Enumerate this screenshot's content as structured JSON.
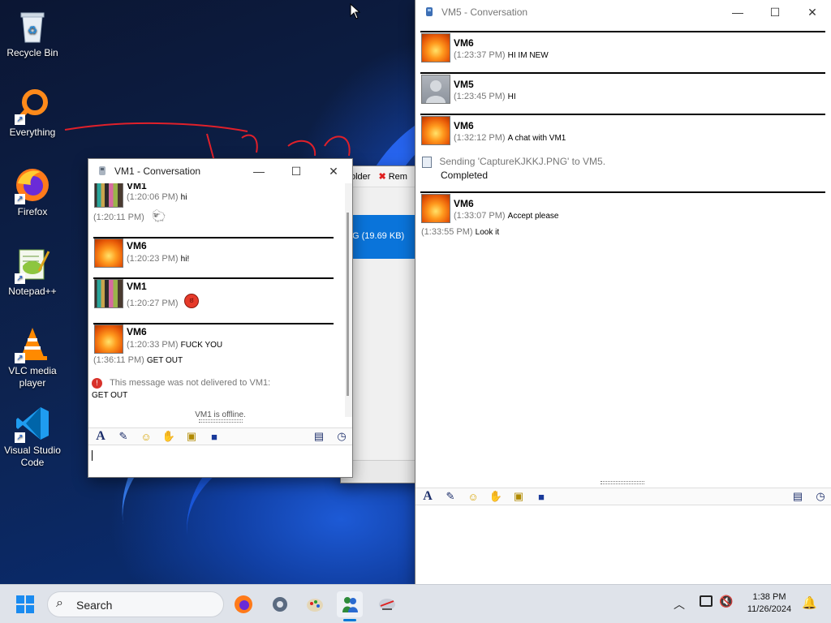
{
  "desktop": {
    "icons": [
      {
        "label": "Recycle Bin",
        "icon": "recycle-bin-icon"
      },
      {
        "label": "Everything",
        "icon": "everything-search-icon"
      },
      {
        "label": "Firefox",
        "icon": "firefox-icon"
      },
      {
        "label": "Notepad++",
        "icon": "notepad-plus-plus-icon"
      },
      {
        "label": "VLC media player",
        "icon": "vlc-cone-icon"
      },
      {
        "label": "Visual Studio Code",
        "icon": "vscode-icon"
      }
    ]
  },
  "background_window": {
    "toolbar_fragment_1": "older",
    "toolbar_fragment_2": "Rem",
    "selected_fragment": "G (19.69 KB)"
  },
  "vm1_window": {
    "title": "VM1 - Conversation",
    "messages": [
      {
        "name": "VM1",
        "time": "(1:20:06 PM)",
        "text": "hi"
      },
      {
        "time": "(1:20:11 PM)",
        "text": "",
        "emoticon": "sheep-emoticon"
      },
      {
        "name": "VM6",
        "time": "(1:20:23 PM)",
        "text": "hi!"
      },
      {
        "name": "VM1",
        "time": "(1:20:27 PM)",
        "text": "",
        "emoticon": "angry-face-emoticon"
      },
      {
        "name": "VM6",
        "time": "(1:20:33 PM)",
        "text": "FUCK YOU"
      },
      {
        "time": "(1:36:11 PM)",
        "text": "GET OUT"
      }
    ],
    "error_text": "This message was not delivered to VM1:",
    "error_body": "GET OUT",
    "status": "VM1 is offline.",
    "input_value": ""
  },
  "vm5_window": {
    "title": "VM5 - Conversation",
    "messages": [
      {
        "name": "VM6",
        "time": "(1:23:37 PM)",
        "text": "HI IM NEW"
      },
      {
        "name": "VM5",
        "time": "(1:23:45 PM)",
        "text": "HI"
      },
      {
        "name": "VM6",
        "time": "(1:32:12 PM)",
        "text": "A chat with VM1"
      },
      {
        "name": "VM6",
        "time": "(1:33:07 PM)",
        "text": "Accept please"
      },
      {
        "time": "(1:33:55 PM)",
        "text": "Look it"
      }
    ],
    "transfer_line1": "Sending 'CaptureKJKKJ.PNG' to VM5.",
    "transfer_line2": "Completed",
    "input_value": ""
  },
  "taskbar": {
    "search_placeholder": "Search",
    "time": "1:38 PM",
    "date": "11/26/2024"
  },
  "colors": {
    "accent": "#0078d7",
    "selection_blue": "#0a74da",
    "annotation_red": "#e0202a"
  }
}
